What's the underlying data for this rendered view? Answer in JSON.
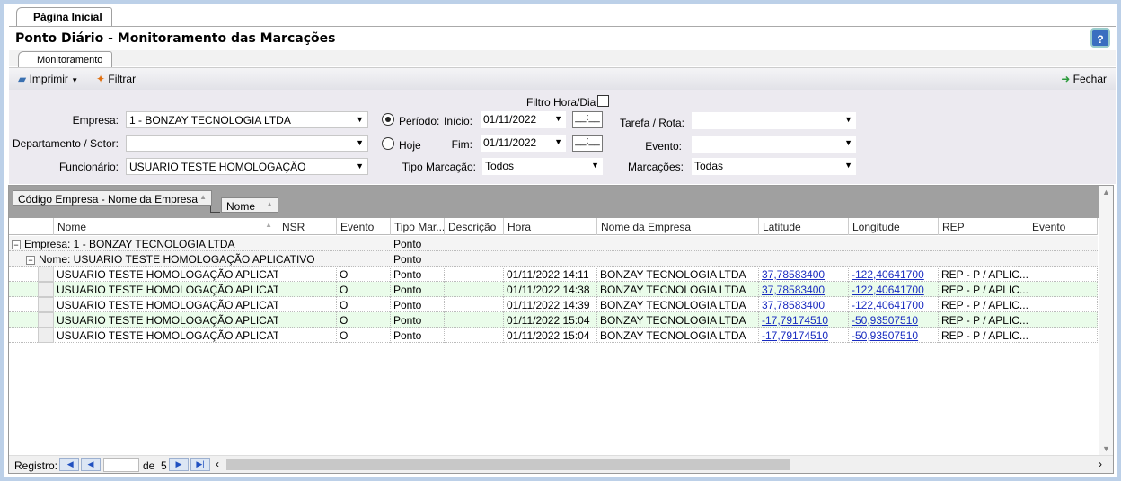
{
  "tabs": {
    "home": "Página Inicial",
    "monitor": "Monitoramento"
  },
  "title": "Ponto Diário - Monitoramento das Marcações",
  "toolbar": {
    "print": "Imprimir",
    "filter": "Filtrar",
    "close": "Fechar"
  },
  "filters": {
    "filtro_hora_dia": "Filtro Hora/Dia",
    "empresa_label": "Empresa:",
    "empresa": "1 - BONZAY TECNOLOGIA LTDA",
    "depto_label": "Departamento / Setor:",
    "depto": "",
    "func_label": "Funcionário:",
    "func": "USUARIO TESTE HOMOLOGAÇÃO",
    "periodo": "Período:",
    "hoje": "Hoje",
    "periodo_selected": true,
    "inicio_label": "Início:",
    "inicio": "01/11/2022",
    "fim_label": "Fim:",
    "fim": "01/11/2022",
    "time_placeholder": "__:__",
    "tipo_label": "Tipo Marcação:",
    "tipo": "Todos",
    "tarefa_label": "Tarefa / Rota:",
    "tarefa": "",
    "evento_label": "Evento:",
    "evento": "",
    "marcacoes_label": "Marcações:",
    "marcacoes": "Todas"
  },
  "grid": {
    "group_by": [
      "Código Empresa - Nome da Empresa",
      "Nome"
    ],
    "columns": [
      "Nome",
      "NSR",
      "Evento",
      "Tipo Mar...",
      "Descrição",
      "Hora",
      "Nome da Empresa",
      "Latitude",
      "Longitude",
      "REP",
      "Evento"
    ],
    "group1": "Empresa:  1 - BONZAY TECNOLOGIA LTDA",
    "group1_tipo": "Ponto",
    "group2": "Nome:  USUARIO TESTE HOMOLOGAÇÃO APLICATIVO",
    "group2_tipo": "Ponto",
    "rows": [
      {
        "nome": "USUARIO  TESTE  HOMOLOGAÇÃO  APLICAT...",
        "nsr": "",
        "evento": "O",
        "tipo": "Ponto",
        "desc": "",
        "hora": "01/11/2022 14:11",
        "empresa": "BONZAY TECNOLOGIA LTDA",
        "lat": "37,78583400",
        "lon": "-122,40641700",
        "rep": "REP - P / APLIC..."
      },
      {
        "nome": "USUARIO  TESTE  HOMOLOGAÇÃO  APLICAT...",
        "nsr": "",
        "evento": "O",
        "tipo": "Ponto",
        "desc": "",
        "hora": "01/11/2022 14:38",
        "empresa": "BONZAY TECNOLOGIA LTDA",
        "lat": "37,78583400",
        "lon": "-122,40641700",
        "rep": "REP - P / APLIC..."
      },
      {
        "nome": "USUARIO  TESTE  HOMOLOGAÇÃO  APLICAT...",
        "nsr": "",
        "evento": "O",
        "tipo": "Ponto",
        "desc": "",
        "hora": "01/11/2022 14:39",
        "empresa": "BONZAY TECNOLOGIA LTDA",
        "lat": "37,78583400",
        "lon": "-122,40641700",
        "rep": "REP - P / APLIC..."
      },
      {
        "nome": "USUARIO  TESTE  HOMOLOGAÇÃO  APLICAT...",
        "nsr": "",
        "evento": "O",
        "tipo": "Ponto",
        "desc": "",
        "hora": "01/11/2022 15:04",
        "empresa": "BONZAY TECNOLOGIA LTDA",
        "lat": "-17,79174510",
        "lon": "-50,93507510",
        "rep": "REP - P / APLIC..."
      },
      {
        "nome": "USUARIO  TESTE  HOMOLOGAÇÃO  APLICAT...",
        "nsr": "",
        "evento": "O",
        "tipo": "Ponto",
        "desc": "",
        "hora": "01/11/2022 15:04",
        "empresa": "BONZAY TECNOLOGIA LTDA",
        "lat": "-17,79174510",
        "lon": "-50,93507510",
        "rep": "REP - P / APLIC..."
      }
    ]
  },
  "footer": {
    "registro": "Registro:",
    "de": "de",
    "total": "5",
    "current": ""
  }
}
